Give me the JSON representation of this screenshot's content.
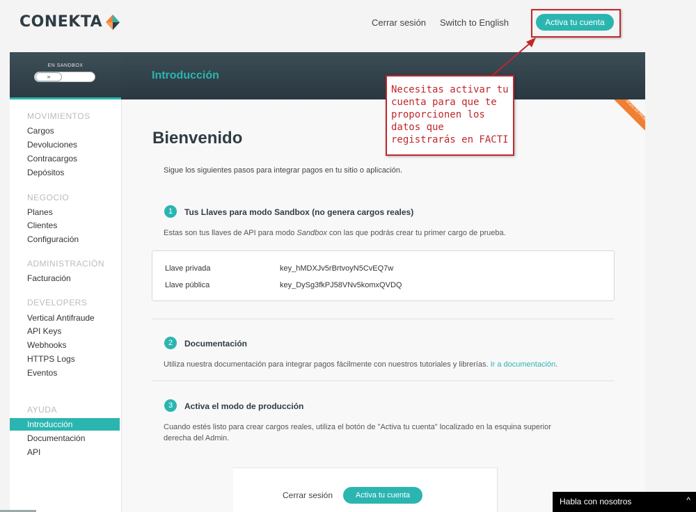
{
  "header": {
    "logo_text": "CONEKTA",
    "logout": "Cerrar sesión",
    "language": "Switch to English",
    "activate": "Activa tu cuenta"
  },
  "sandbox": {
    "label": "EN SANDBOX",
    "toggle_glyph": "»"
  },
  "page_title": "Introducción",
  "ribbon": "MODO DE PRUEBA",
  "sidebar": {
    "sections": [
      {
        "title": "MOVIMIENTOS",
        "items": [
          "Cargos",
          "Devoluciones",
          "Contracargos",
          "Depósitos"
        ]
      },
      {
        "title": "NEGOCIO",
        "items": [
          "Planes",
          "Clientes",
          "Configuración"
        ]
      },
      {
        "title": "ADMINISTRACIÓN",
        "items": [
          "Facturación"
        ]
      },
      {
        "title": "DEVELOPERS",
        "items": [
          "Vertical Antifraude",
          "API Keys",
          "Webhooks",
          "HTTPS Logs",
          "Eventos"
        ]
      },
      {
        "title": "AYUDA",
        "items": [
          "Introducción",
          "Documentación",
          "API"
        ]
      }
    ],
    "active_item": "Introducción"
  },
  "main": {
    "welcome": "Bienvenido",
    "intro": "Sigue los siguientes pasos para integrar pagos en tu sitio o aplicación.",
    "steps": [
      {
        "num": "1",
        "title": "Tus Llaves para modo Sandbox (no genera cargos reales)",
        "desc_pre": "Estas son tus llaves de API para modo ",
        "desc_em": "Sandbox",
        "desc_post": " con las que podrás crear tu primer cargo de prueba."
      },
      {
        "num": "2",
        "title": "Documentación",
        "desc": "Utiliza nuestra documentación para integrar pagos fácilmente con nuestros tutoriales y librerías.",
        "link": "Ir a documentación"
      },
      {
        "num": "3",
        "title": "Activa el modo de producción",
        "desc_line1": "Cuando estés listo para crear cargos reales, utiliza el botón de \"Activa tu cuenta\" localizado en la esquina superior",
        "desc_line2": "derecha del Admin."
      }
    ],
    "keys": {
      "private_label": "Llave privada",
      "private_value": "key_hMDXJv5rBrtvoyN5CvEQ7w",
      "public_label": "Llave pública",
      "public_value": "key_DySg3fkPJ58VNv5komxQVDQ"
    },
    "bottom_logout": "Cerrar sesión",
    "bottom_activate": "Activa tu cuenta"
  },
  "callout": {
    "lines": [
      "Necesitas activar tu",
      "cuenta para que te",
      "proporcionen los",
      "datos que",
      "registrarás en FACTI"
    ]
  },
  "chat": {
    "label": "Habla con nosotros",
    "caret": "^"
  },
  "colors": {
    "accent": "#2bb5b0",
    "annotation_red": "#c0272d",
    "ribbon_orange": "#f07f33",
    "header_dark": "#2f3c45"
  }
}
